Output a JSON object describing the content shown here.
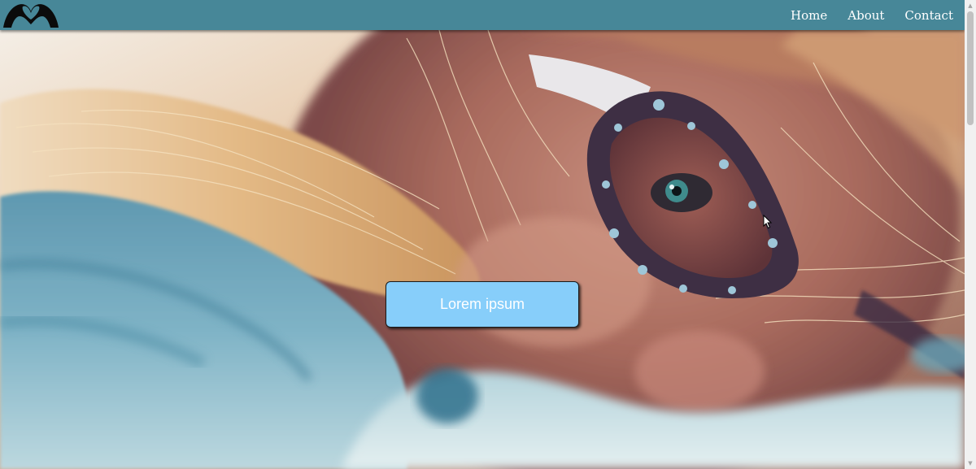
{
  "navbar": {
    "logo": "hands-heart-logo-icon",
    "links": [
      {
        "label": "Home"
      },
      {
        "label": "About"
      },
      {
        "label": "Contact"
      }
    ]
  },
  "hero": {
    "image": "woman-with-polka-dot-glasses-photo",
    "button_label": "Lorem ipsum"
  },
  "colors": {
    "navbar_bg": "#478798",
    "nav_text": "#ffffff",
    "button_bg": "#87cefa",
    "button_text": "#ffffff"
  },
  "scrollbar": {
    "up_icon": "scroll-up-arrow-icon",
    "down_icon": "scroll-down-arrow-icon"
  }
}
